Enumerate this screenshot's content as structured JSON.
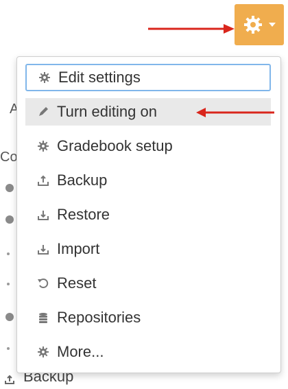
{
  "trigger": {
    "icon": "gear-icon",
    "caret": "caret-down-icon",
    "color": "#f0ad4e"
  },
  "menu": {
    "items": [
      {
        "label": "Edit settings",
        "icon": "gear-icon",
        "state": "focused"
      },
      {
        "label": "Turn editing on",
        "icon": "pencil-icon",
        "state": "hovered"
      },
      {
        "label": "Gradebook setup",
        "icon": "gear-icon"
      },
      {
        "label": "Backup",
        "icon": "upload-icon"
      },
      {
        "label": "Restore",
        "icon": "download-icon"
      },
      {
        "label": "Import",
        "icon": "download-icon"
      },
      {
        "label": "Reset",
        "icon": "reset-icon"
      },
      {
        "label": "Repositories",
        "icon": "database-icon"
      },
      {
        "label": "More...",
        "icon": "gear-icon"
      }
    ]
  },
  "background": {
    "fragment_a": "A",
    "fragment_co": "Co",
    "bottom_item": "Backup"
  },
  "annotations": {
    "arrow_color": "#d9261c"
  }
}
